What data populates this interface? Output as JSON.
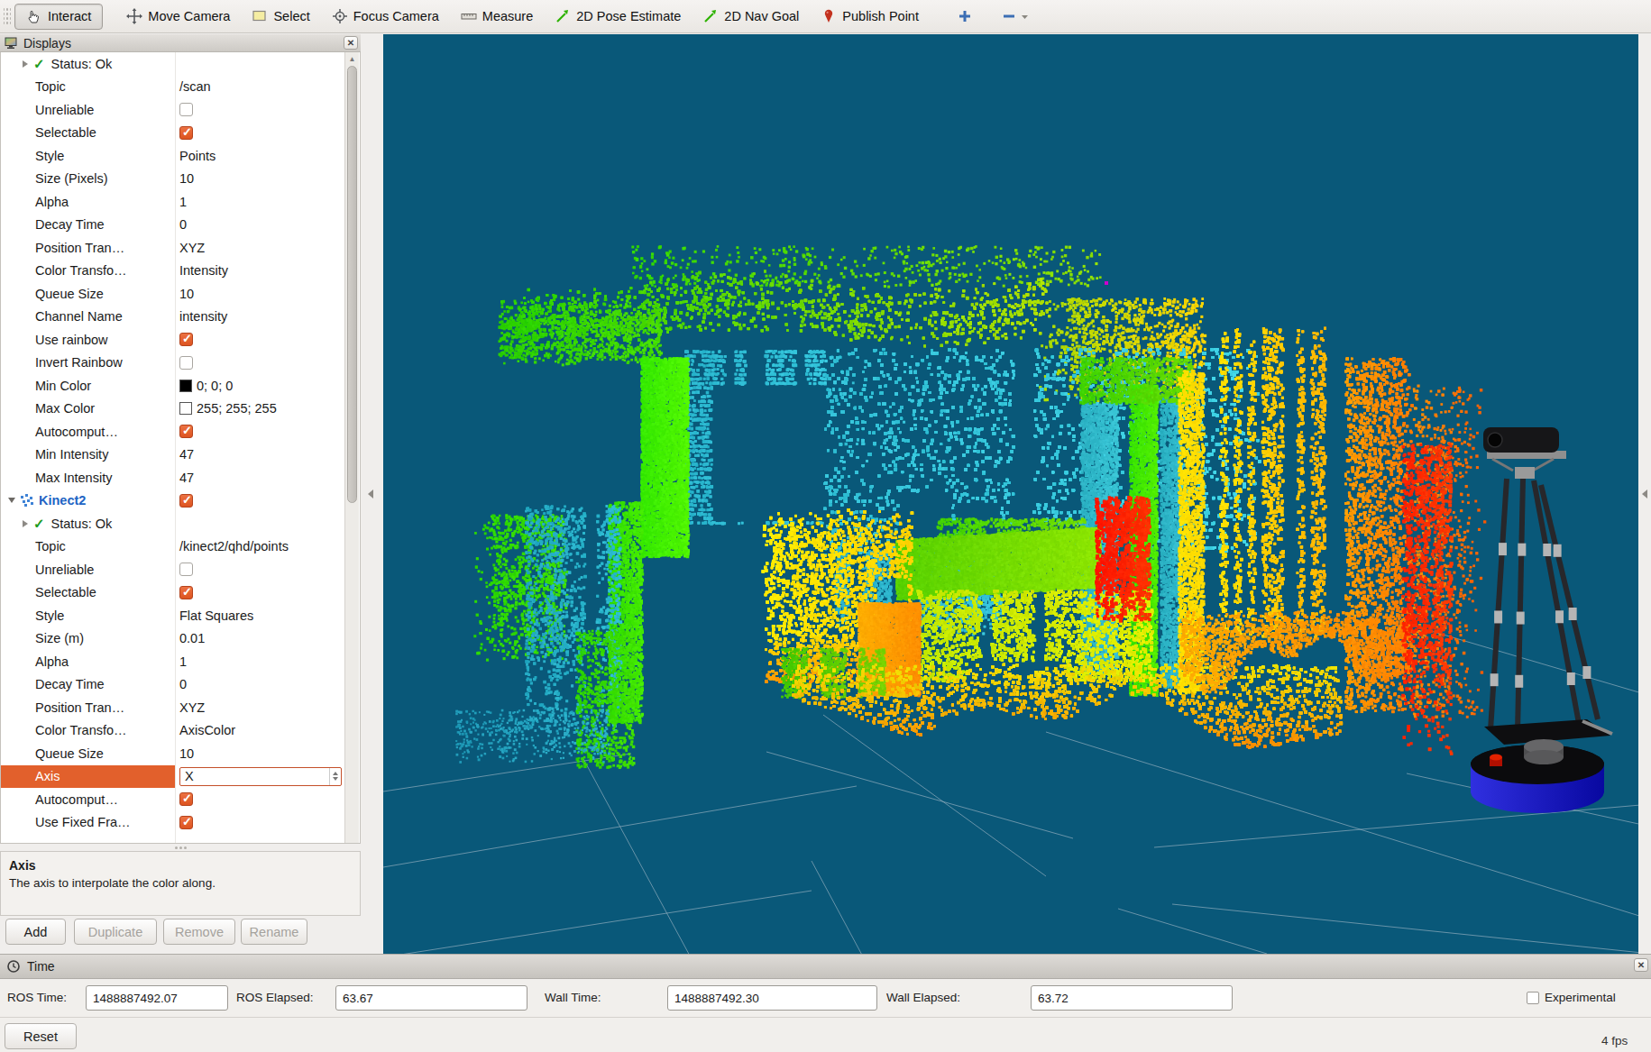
{
  "toolbar": {
    "tools": [
      {
        "id": "interact",
        "label": "Interact",
        "active": true
      },
      {
        "id": "move-camera",
        "label": "Move Camera"
      },
      {
        "id": "select",
        "label": "Select"
      },
      {
        "id": "focus-camera",
        "label": "Focus Camera"
      },
      {
        "id": "measure",
        "label": "Measure"
      },
      {
        "id": "pose-estimate",
        "label": "2D Pose Estimate"
      },
      {
        "id": "nav-goal",
        "label": "2D Nav Goal"
      },
      {
        "id": "publish-point",
        "label": "Publish Point"
      },
      {
        "id": "add-tool",
        "label": ""
      },
      {
        "id": "remove-tool",
        "label": ""
      }
    ]
  },
  "displays": {
    "title": "Displays",
    "rows": [
      {
        "label": "Status: Ok",
        "type": "status"
      },
      {
        "label": "Topic",
        "value": "/scan"
      },
      {
        "label": "Unreliable",
        "type": "checkbox",
        "checked": false
      },
      {
        "label": "Selectable",
        "type": "checkbox",
        "checked": true
      },
      {
        "label": "Style",
        "value": "Points"
      },
      {
        "label": "Size (Pixels)",
        "value": "10"
      },
      {
        "label": "Alpha",
        "value": "1"
      },
      {
        "label": "Decay Time",
        "value": "0"
      },
      {
        "label": "Position Tran…",
        "value": "XYZ"
      },
      {
        "label": "Color Transfo…",
        "value": "Intensity"
      },
      {
        "label": "Queue Size",
        "value": "10"
      },
      {
        "label": "Channel Name",
        "value": "intensity"
      },
      {
        "label": "Use rainbow",
        "type": "checkbox",
        "checked": true
      },
      {
        "label": "Invert Rainbow",
        "type": "checkbox",
        "checked": false
      },
      {
        "label": "Min Color",
        "type": "color",
        "swatch": "#000000",
        "value": "0; 0; 0"
      },
      {
        "label": "Max Color",
        "type": "color",
        "swatch": "#ffffff",
        "value": "255; 255; 255"
      },
      {
        "label": "Autocomput…",
        "type": "checkbox",
        "checked": true
      },
      {
        "label": "Min Intensity",
        "value": "47"
      },
      {
        "label": "Max Intensity",
        "value": "47"
      },
      {
        "label": "Kinect2",
        "type": "display",
        "checked": true
      },
      {
        "label": "Status: Ok",
        "type": "status"
      },
      {
        "label": "Topic",
        "value": "/kinect2/qhd/points"
      },
      {
        "label": "Unreliable",
        "type": "checkbox",
        "checked": false
      },
      {
        "label": "Selectable",
        "type": "checkbox",
        "checked": true
      },
      {
        "label": "Style",
        "value": "Flat Squares"
      },
      {
        "label": "Size (m)",
        "value": "0.01"
      },
      {
        "label": "Alpha",
        "value": "1"
      },
      {
        "label": "Decay Time",
        "value": "0"
      },
      {
        "label": "Position Tran…",
        "value": "XYZ"
      },
      {
        "label": "Color Transfo…",
        "value": "AxisColor"
      },
      {
        "label": "Queue Size",
        "value": "10"
      },
      {
        "label": "Axis",
        "type": "dropdown",
        "value": "X",
        "selected": true
      },
      {
        "label": "Autocomput…",
        "type": "checkbox",
        "checked": true
      },
      {
        "label": "Use Fixed Fra…",
        "type": "checkbox",
        "checked": true
      }
    ],
    "description": {
      "title": "Axis",
      "text": "The axis to interpolate the color along."
    },
    "buttons": [
      {
        "label": "Add",
        "enabled": true
      },
      {
        "label": "Duplicate",
        "enabled": false
      },
      {
        "label": "Remove",
        "enabled": false
      },
      {
        "label": "Rename",
        "enabled": false
      }
    ]
  },
  "time_panel": {
    "title": "Time",
    "fields": [
      {
        "label": "ROS Time:",
        "value": "1488887492.07"
      },
      {
        "label": "ROS Elapsed:",
        "value": "63.67"
      },
      {
        "label": "Wall Time:",
        "value": "1488887492.30"
      },
      {
        "label": "Wall Elapsed:",
        "value": "63.72"
      }
    ],
    "experimental_label": "Experimental"
  },
  "statusbar": {
    "reset_label": "Reset",
    "fps": "4 fps"
  },
  "viewport": {
    "background": "#095879",
    "grid_color": "#9bb4c1",
    "robot": {
      "base_color": "#1818c8",
      "frame_color": "#27272b",
      "clamp_color": "#b5b5b5"
    },
    "point_cloud": {
      "style": "rainbow-axis-color",
      "palette": [
        "#28d400",
        "#b0e000",
        "#32c0d6",
        "#40d4e6",
        "#36ea00",
        "#ffe000",
        "#ffb200",
        "#ff7a00",
        "#ff2200",
        "#ffec00",
        "#c0e800",
        "#ff7200"
      ]
    }
  }
}
